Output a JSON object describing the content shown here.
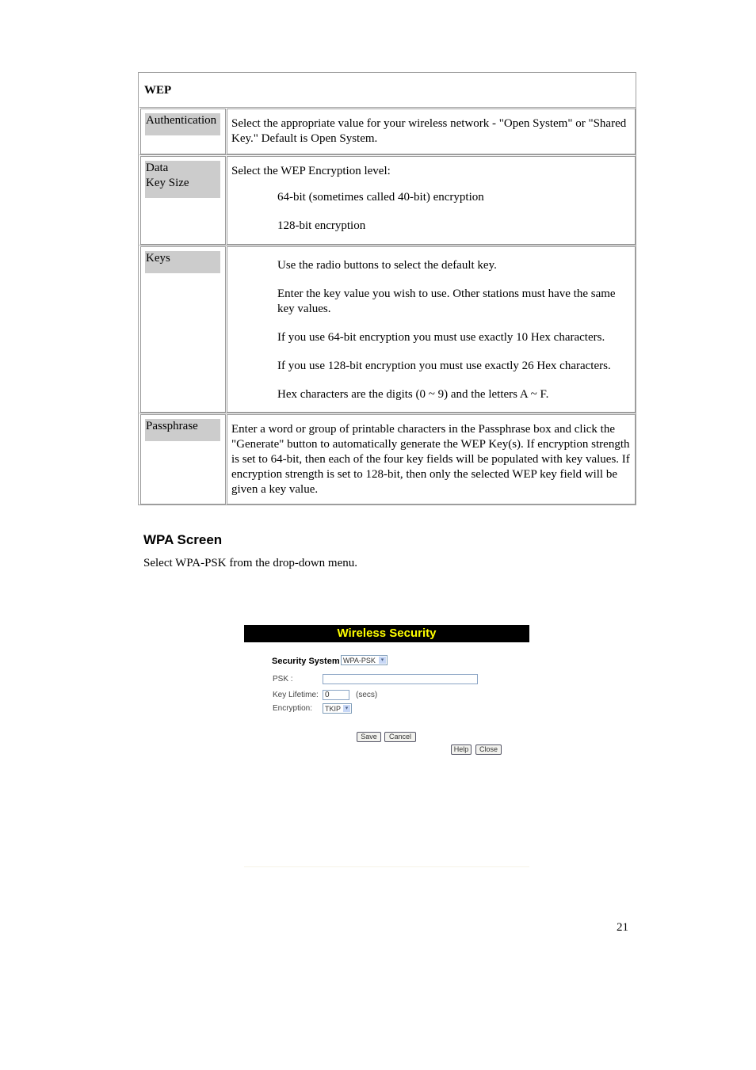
{
  "wep_table": {
    "header": "WEP",
    "rows": [
      {
        "label_lines": [
          "Authentication"
        ],
        "description": "Select the appropriate value for your wireless network - \"Open System\" or \"Shared Key.\" Default is Open System."
      },
      {
        "label_lines": [
          "Data",
          "Key Size"
        ],
        "intro": "Select the WEP Encryption level:",
        "options": [
          "64-bit (sometimes called 40-bit) encryption",
          "128-bit encryption"
        ]
      },
      {
        "label_lines": [
          "Keys"
        ],
        "paragraphs": [
          "Use the radio buttons to select the default key.",
          "Enter the key value you wish to use. Other stations must have the same key values.",
          "If you use 64-bit encryption you must use exactly 10 Hex characters.",
          "If you use 128-bit encryption you must use exactly 26 Hex characters.",
          "Hex characters are the digits (0 ~ 9) and the letters A ~ F."
        ]
      },
      {
        "label_lines": [
          "Passphrase"
        ],
        "description": "Enter a word or group of printable characters in the Passphrase box and click the \"Generate\" button to automatically generate the WEP Key(s). If encryption strength is set to 64-bit, then each of the four key fields will be populated with key values. If encryption strength is set to 128-bit, then only the selected WEP key field will be given a key value."
      }
    ]
  },
  "wpa_section": {
    "title": "WPA Screen",
    "text": "Select WPA-PSK from the drop-down menu."
  },
  "screenshot": {
    "title": "Wireless Security",
    "title_color": "#ffff00",
    "security_system_label": "Security System",
    "security_system_value": "WPA-PSK",
    "psk_label": "PSK :",
    "psk_value": "",
    "key_lifetime_label": "Key Lifetime:",
    "key_lifetime_value": "0",
    "key_lifetime_unit": "(secs)",
    "encryption_label": "Encryption:",
    "encryption_value": "TKIP",
    "buttons": {
      "save": "Save",
      "cancel": "Cancel",
      "help": "Help",
      "close": "Close"
    },
    "dropdown_arrow": "▾"
  },
  "page_number": "21"
}
